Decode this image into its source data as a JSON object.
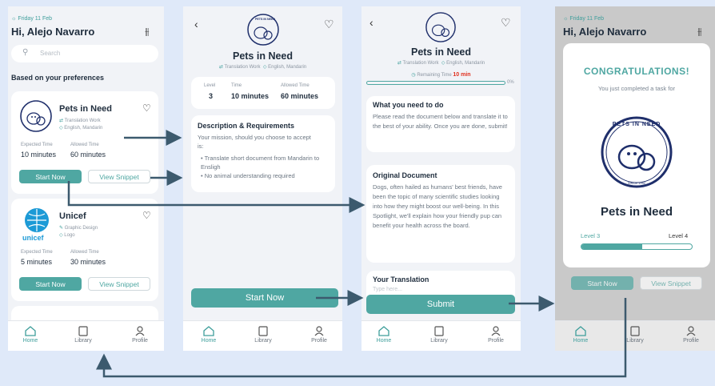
{
  "home": {
    "date": "Friday 11 Feb",
    "greeting": "Hi, Alejo Navarro",
    "search_placeholder": "Search",
    "section_title": "Based on your preferences",
    "tasks": [
      {
        "name": "Pets in Need",
        "tag1": "Translation Work",
        "tag2": "English, Mandarin",
        "expected_label": "Expected Time",
        "expected": "10 minutes",
        "allowed_label": "Allowed Time",
        "allowed": "60 minutes",
        "start": "Start Now",
        "snippet": "View Snippet"
      },
      {
        "name": "Unicef",
        "logo_text": "unicef",
        "tag1": "Graphic Design",
        "tag2": "Logo",
        "expected_label": "Expected Time",
        "expected": "5 minutes",
        "allowed_label": "Allowed Time",
        "allowed": "30 minutes",
        "start": "Start Now",
        "snippet": "View Snippet"
      }
    ]
  },
  "nav": {
    "home": "Home",
    "library": "Library",
    "profile": "Profile"
  },
  "detail": {
    "logo_text": "PETS IN NEED",
    "title": "Pets in Need",
    "tag1": "Translation Work",
    "tag2": "English, Mandarin",
    "level_label": "Level",
    "level": "3",
    "time_label": "Time",
    "time": "10 minutes",
    "allowed_label": "Allowed Time",
    "allowed": "60 minutes",
    "desc_title": "Description & Requirements",
    "desc_text": "Your mission, should you choose to accept is:",
    "bullets": [
      "Translate short document from Mandarin to Ensligh",
      "No animal understanding required"
    ],
    "start": "Start Now"
  },
  "task": {
    "title": "Pets in Need",
    "tag1": "Translation Work",
    "tag2": "English, Mandarin",
    "remaining_label": "Remaining Time",
    "remaining": "10 min",
    "progress_min": "0",
    "progress_pct": "0%",
    "todo_title": "What you need to do",
    "todo_text": "Please read the document below and translate it to the best of your ability. Once you are done, submit!",
    "doc_title": "Original Document",
    "doc_text": "Dogs, often hailed as humans' best friends, have been the topic of many scientific studies looking into how they might boost our well-being. In this Spotlight, we'll explain how your friendly pup can benefit your health across the board.",
    "translation_title": "Your Translation",
    "translation_placeholder": "Type here...",
    "submit": "Submit"
  },
  "done": {
    "date": "Friday 11 Feb",
    "greeting": "Hi, Alejo Navarro",
    "congrats": "CONGRATULATIONS!",
    "subtitle": "You just completed a task for",
    "logo_top": "PETS IN NEED",
    "logo_bottom": "SINCE 1992",
    "org": "Pets in Need",
    "level_from": "Level 3",
    "level_to": "Level 4",
    "level_progress": 0.55,
    "start": "Start Now",
    "snippet": "View Snippet"
  },
  "colors": {
    "accent": "#4fa7a2",
    "danger": "#e0301e",
    "arrow": "#3c5a6e",
    "bg": "#dfe9f9"
  }
}
